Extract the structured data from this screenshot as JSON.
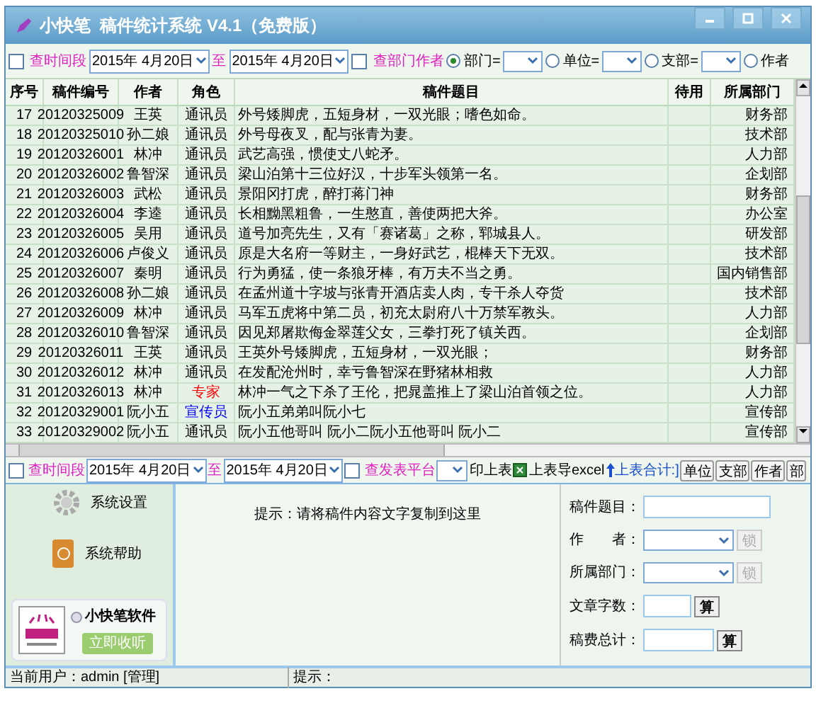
{
  "window": {
    "title": "小快笔  稿件统计系统 V4.1（免费版）"
  },
  "filter_bar": {
    "time_check": {
      "label": "查时间段",
      "checked": false
    },
    "date_from": "2015年  4月20日",
    "to_label": "至",
    "date_to": "2015年  4月20日",
    "dept_check": {
      "label": "查部门作者",
      "checked": false
    },
    "radios": [
      {
        "label": "部门=",
        "selected": true
      },
      {
        "label": "单位=",
        "selected": false
      },
      {
        "label": "支部=",
        "selected": false
      },
      {
        "label": "作者",
        "selected": false
      }
    ]
  },
  "table": {
    "columns": [
      "序号",
      "稿件编号",
      "作者",
      "角色",
      "稿件题目",
      "待用",
      "所属部门"
    ],
    "rows": [
      {
        "no": "17",
        "code": "20120325009",
        "author": "王英",
        "role": {
          "text": "通讯员",
          "color": "#000000"
        },
        "title": "外号矮脚虎，五短身材，一双光眼；嗜色如命。",
        "dept": "财务部"
      },
      {
        "no": "18",
        "code": "20120325010",
        "author": "孙二娘",
        "role": {
          "text": "通讯员",
          "color": "#000000"
        },
        "title": "外号母夜叉，配与张青为妻。",
        "dept": "技术部"
      },
      {
        "no": "19",
        "code": "20120326001",
        "author": "林冲",
        "role": {
          "text": "通讯员",
          "color": "#000000"
        },
        "title": "武艺高强，惯使丈八蛇矛。",
        "dept": "人力部"
      },
      {
        "no": "20",
        "code": "20120326002",
        "author": "鲁智深",
        "role": {
          "text": "通讯员",
          "color": "#000000"
        },
        "title": "梁山泊第十三位好汉，十步军头领第一名。",
        "dept": "企划部"
      },
      {
        "no": "21",
        "code": "20120326003",
        "author": "武松",
        "role": {
          "text": "通讯员",
          "color": "#000000"
        },
        "title": "景阳冈打虎，醉打蒋门神",
        "dept": "财务部"
      },
      {
        "no": "22",
        "code": "20120326004",
        "author": "李逵",
        "role": {
          "text": "通讯员",
          "color": "#000000"
        },
        "title": "长相黝黑粗鲁，一生憨直，善使两把大斧。",
        "dept": "办公室"
      },
      {
        "no": "23",
        "code": "20120326005",
        "author": "吴用",
        "role": {
          "text": "通讯员",
          "color": "#000000"
        },
        "title": "道号加亮先生，又有「赛诸葛」之称，郓城县人。",
        "dept": "研发部"
      },
      {
        "no": "24",
        "code": "20120326006",
        "author": "卢俊义",
        "role": {
          "text": "通讯员",
          "color": "#000000"
        },
        "title": "原是大名府一等财主，一身好武艺，棍棒天下无双。",
        "dept": "技术部"
      },
      {
        "no": "25",
        "code": "20120326007",
        "author": "秦明",
        "role": {
          "text": "通讯员",
          "color": "#000000"
        },
        "title": "行为勇猛，使一条狼牙棒，有万夫不当之勇。",
        "dept": "国内销售部"
      },
      {
        "no": "26",
        "code": "20120326008",
        "author": "孙二娘",
        "role": {
          "text": "通讯员",
          "color": "#000000"
        },
        "title": "在孟州道十字坡与张青开酒店卖人肉，专干杀人夺货",
        "dept": "技术部"
      },
      {
        "no": "27",
        "code": "20120326009",
        "author": "林冲",
        "role": {
          "text": "通讯员",
          "color": "#000000"
        },
        "title": "马军五虎将中第二员，初充太尉府八十万禁军教头。",
        "dept": "人力部"
      },
      {
        "no": "28",
        "code": "20120326010",
        "author": "鲁智深",
        "role": {
          "text": "通讯员",
          "color": "#000000"
        },
        "title": "因见郑屠欺侮金翠莲父女，三拳打死了镇关西。",
        "dept": "企划部"
      },
      {
        "no": "29",
        "code": "20120326011",
        "author": "王英",
        "role": {
          "text": "通讯员",
          "color": "#000000"
        },
        "title": "王英外号矮脚虎，五短身材，一双光眼；",
        "dept": "财务部"
      },
      {
        "no": "30",
        "code": "20120326012",
        "author": "林冲",
        "role": {
          "text": "通讯员",
          "color": "#000000"
        },
        "title": "在发配沧州时，幸亏鲁智深在野猪林相救",
        "dept": "人力部"
      },
      {
        "no": "31",
        "code": "20120326013",
        "author": "林冲",
        "role": {
          "text": "专家",
          "color": "#ff0000"
        },
        "title": "林冲一气之下杀了王伦，把晁盖推上了梁山泊首领之位。",
        "dept": "人力部"
      },
      {
        "no": "32",
        "code": "20120329001",
        "author": "阮小五",
        "role": {
          "text": "宣传员",
          "color": "#0000ff"
        },
        "title": "阮小五弟弟叫阮小七",
        "dept": "宣传部"
      },
      {
        "no": "33",
        "code": "20120329002",
        "author": "阮小五",
        "role": {
          "text": "通讯员",
          "color": "#000000"
        },
        "title": "阮小五他哥叫 阮小二阮小五他哥叫 阮小二",
        "dept": "宣传部"
      }
    ]
  },
  "toolbar": {
    "time_check": {
      "label": "查时间段",
      "checked": false
    },
    "date_from": "2015年  4月20日",
    "to_label": "至",
    "date_to": "2015年  4月20日",
    "platform_check": {
      "label": "查发表平台",
      "checked": false
    },
    "print": "印上表",
    "export": "上表导excel",
    "sum": "上表合计:]",
    "buttons": [
      "单位",
      "支部",
      "作者",
      "部"
    ]
  },
  "sidebar": {
    "items": [
      "系统设置",
      "系统帮助"
    ],
    "promo": {
      "name": "小快笔软件",
      "button": "立即收听"
    }
  },
  "editor": {
    "hint": "提示：请将稿件内容文字复制到这里"
  },
  "form": {
    "title_label": "稿件题目：",
    "author_label": "作　　者：",
    "author_lock": "锁",
    "dept_label": "所属部门：",
    "dept_lock": "锁",
    "count_label": "文章字数：",
    "count_button": "算",
    "fee_label": "稿费总计：",
    "fee_button": "算"
  },
  "status_bar": {
    "user": "当前用户：admin [管理]",
    "hint": "提示："
  }
}
